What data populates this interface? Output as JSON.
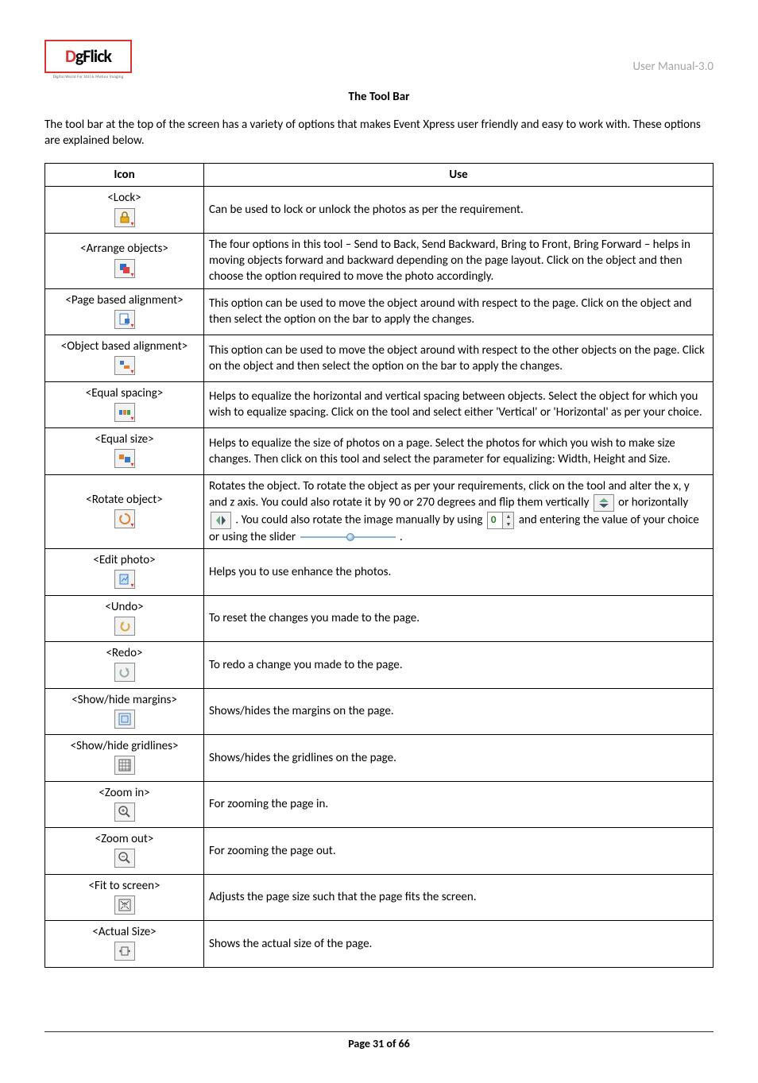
{
  "header": {
    "logo_main": "DgFlick",
    "logo_sub": "Digital World For Still & Motion Imaging",
    "manual_label": "User Manual-3.0"
  },
  "section_title": "The Tool Bar",
  "intro": "The tool bar at the top of the screen has a variety of options that makes Event Xpress user friendly and easy to work with. These options are explained below.",
  "table": {
    "header_icon": "Icon",
    "header_use": "Use",
    "rows": [
      {
        "label": "<Lock>",
        "use": "Can be used to lock or unlock the photos as per the requirement."
      },
      {
        "label": "<Arrange objects>",
        "use": "The four options in this tool – Send to Back, Send Backward, Bring to Front, Bring Forward – helps in moving objects forward and backward depending on the page layout. Click on the object and then choose the option required to move the photo accordingly."
      },
      {
        "label": "<Page based alignment>",
        "use": "This option can be used to move the object around with respect to the page. Click on the object and then select the option on the bar to apply the changes."
      },
      {
        "label": "<Object based alignment>",
        "use": "This option can be used to move the object around with respect to the other objects on the page. Click on the object and then select the option on the bar to apply the changes."
      },
      {
        "label": "<Equal spacing>",
        "use": "Helps to equalize the horizontal and vertical spacing between objects. Select the object for which you wish to equalize spacing. Click on the tool and select either 'Vertical' or 'Horizontal' as per your choice."
      },
      {
        "label": "<Equal size>",
        "use": "Helps to equalize the size of photos on a page. Select the photos for which you wish to make size changes. Then click on this tool and select the parameter for equalizing: Width, Height and Size."
      },
      {
        "label": "<Rotate object>",
        "use_parts": {
          "p1": "Rotates the object. To rotate the object as per your requirements, click on the tool and alter the x, y and z axis. You could also rotate it by 90 or 270 degrees and flip them vertically ",
          "p2": " or horizontally ",
          "p3": ". You could also rotate the image manually by using ",
          "p4": " and entering the value of your choice or using the slider ",
          "p5": "."
        },
        "spinner_value": "0"
      },
      {
        "label": "<Edit photo>",
        "use": "Helps you to use enhance the photos."
      },
      {
        "label": "<Undo>",
        "use": "To reset the changes you made to the page."
      },
      {
        "label": "<Redo>",
        "use": "To redo a change you made to the page."
      },
      {
        "label": "<Show/hide margins>",
        "use": "Shows/hides the margins on the page."
      },
      {
        "label": "<Show/hide gridlines>",
        "use": "Shows/hides the gridlines on the page."
      },
      {
        "label": "<Zoom in>",
        "use": "For zooming the page in."
      },
      {
        "label": "<Zoom out>",
        "use": "For zooming the page out."
      },
      {
        "label": "<Fit to screen>",
        "use": "Adjusts the page size such that the page fits the screen."
      },
      {
        "label": "<Actual Size>",
        "use": "Shows the actual size of the page."
      }
    ]
  },
  "footer": {
    "page_label_prefix": "Page ",
    "page_current": "31",
    "page_of": " of ",
    "page_total": "66"
  }
}
